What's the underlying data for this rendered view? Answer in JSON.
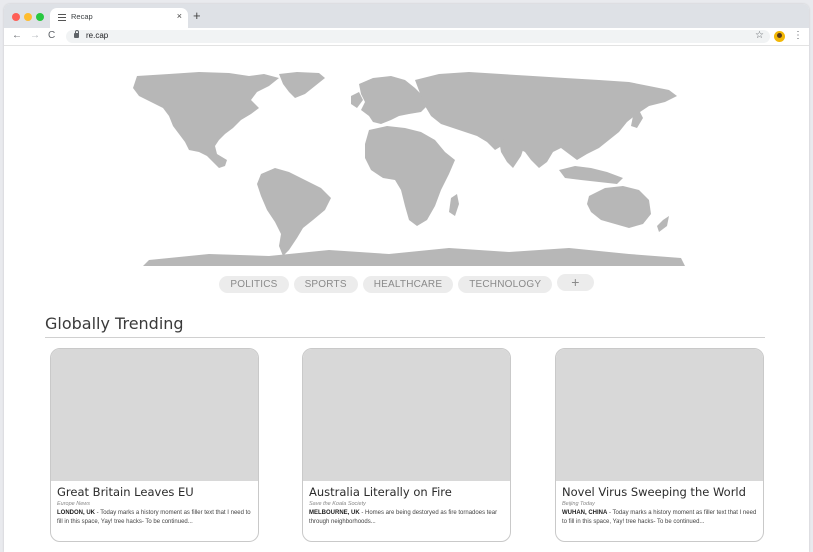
{
  "browser": {
    "tab_title": "Recap",
    "tab_close": "×",
    "new_tab": "+",
    "url": "re.cap",
    "nav": {
      "back": "←",
      "forward": "→",
      "reload": "C"
    },
    "star": "☆",
    "menu": "⋮"
  },
  "categories": [
    "POLITICS",
    "SPORTS",
    "HEALTHCARE",
    "TECHNOLOGY",
    "+"
  ],
  "section": {
    "title": "Globally Trending"
  },
  "cards": [
    {
      "title": "Great Britain Leaves EU",
      "source": "Europe News",
      "location": "LONDON, UK",
      "text": " - Today marks a history moment as filler text that I need to fill in this space, Yay! tree hacks- To be continued..."
    },
    {
      "title": "Australia Literally on Fire",
      "source": "Save the Koala Society",
      "location": "MELBOURNE, UK",
      "text": " - Homes are being destoryed as fire tornadoes tear through neighborhoods..."
    },
    {
      "title": "Novel Virus Sweeping the World",
      "source": "Beijing Today",
      "location": "WUHAN, CHINA",
      "text": " - Today marks a history moment as filler text that I need to fill in this space, Yay! tree hacks- To be continued..."
    }
  ],
  "colors": {
    "map_land": "#b7b7b7",
    "chip_bg": "#ececec",
    "card_image": "#d8d8d8"
  }
}
